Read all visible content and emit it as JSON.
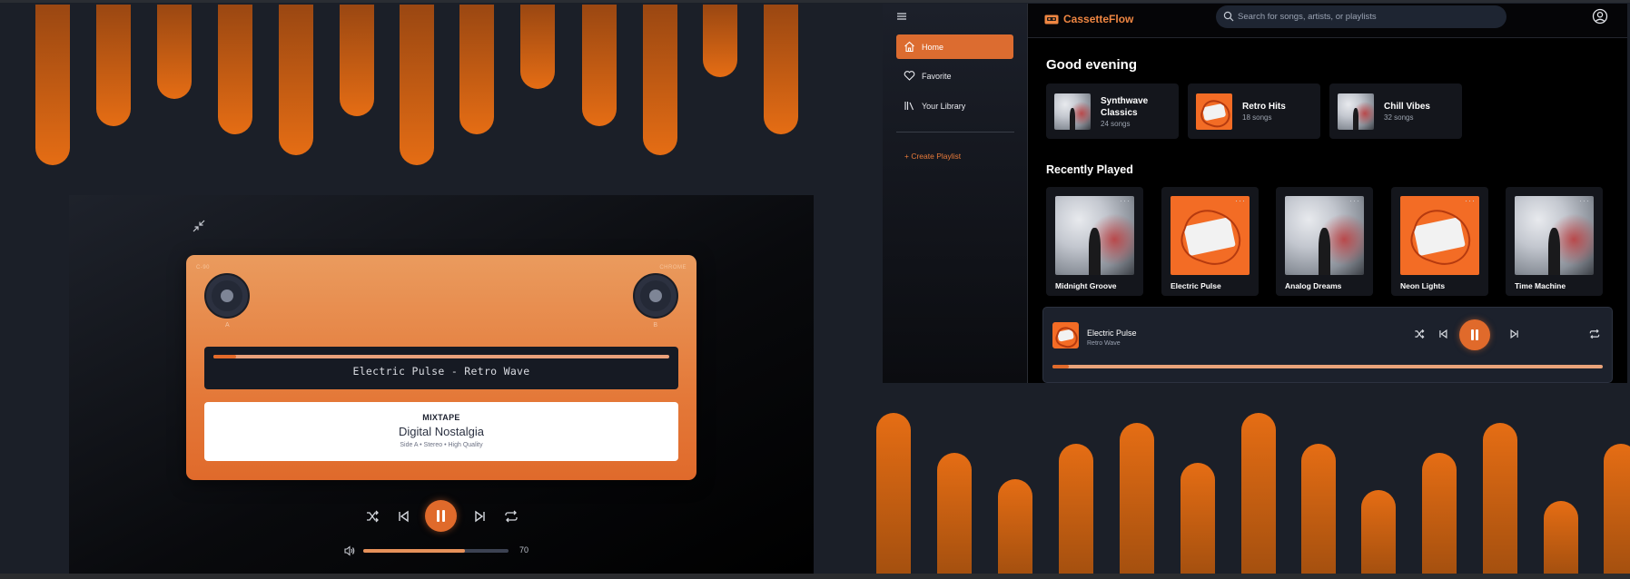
{
  "colors": {
    "accent": "#e06a2b",
    "accent_light": "#ef8642",
    "background": "#1b1f28",
    "sidebar": "#1c202a"
  },
  "fullscreen_player": {
    "minimize_icon": "minimize-icon",
    "cassette": {
      "corner_left": "C-90",
      "corner_right": "CHROME",
      "reel_a_label": "A",
      "reel_b_label": "B",
      "now_playing": "Electric Pulse - Retro Wave",
      "tape_progress": 0.05,
      "label_kicker": "MIXTAPE",
      "label_title": "Digital Nostalgia",
      "label_meta": "Side A • Stereo • High Quality"
    },
    "controls": {
      "shuffle_icon": "shuffle-icon",
      "previous_icon": "skip-back-icon",
      "play_pause_icon": "pause-icon",
      "next_icon": "skip-forward-icon",
      "repeat_icon": "repeat-icon"
    },
    "volume": {
      "icon": "volume-icon",
      "value": "70",
      "level": 0.7
    }
  },
  "app": {
    "sidebar": {
      "menu_icon": "hamburger-menu-icon",
      "items": [
        {
          "label": "Home",
          "icon": "home-icon",
          "active": true
        },
        {
          "label": "Favorite",
          "icon": "heart-icon",
          "active": false
        },
        {
          "label": "Your Library",
          "icon": "library-icon",
          "active": false
        }
      ],
      "create_playlist": "+ Create Playlist"
    },
    "header": {
      "logo_text": "CassetteFlow",
      "logo_icon": "cassette-icon",
      "search_placeholder": "Search for songs, artists, or playlists",
      "user_icon": "user-circle-icon"
    },
    "greeting": "Good evening",
    "quick_picks": [
      {
        "title": "Synthwave Classics",
        "subtitle": "24 songs",
        "art": "smoke"
      },
      {
        "title": "Retro Hits",
        "subtitle": "18 songs",
        "art": "tape"
      },
      {
        "title": "Chill Vibes",
        "subtitle": "32 songs",
        "art": "smoke"
      }
    ],
    "recently_played_title": "Recently Played",
    "recently_played": [
      {
        "title": "Midnight Groove",
        "art": "smoke"
      },
      {
        "title": "Electric Pulse",
        "art": "tape"
      },
      {
        "title": "Analog Dreams",
        "art": "smoke"
      },
      {
        "title": "Neon Lights",
        "art": "tape"
      },
      {
        "title": "Time Machine",
        "art": "smoke"
      }
    ],
    "more_label": "···",
    "mini_player": {
      "title": "Electric Pulse",
      "artist": "Retro Wave",
      "progress": 0.03
    }
  }
}
